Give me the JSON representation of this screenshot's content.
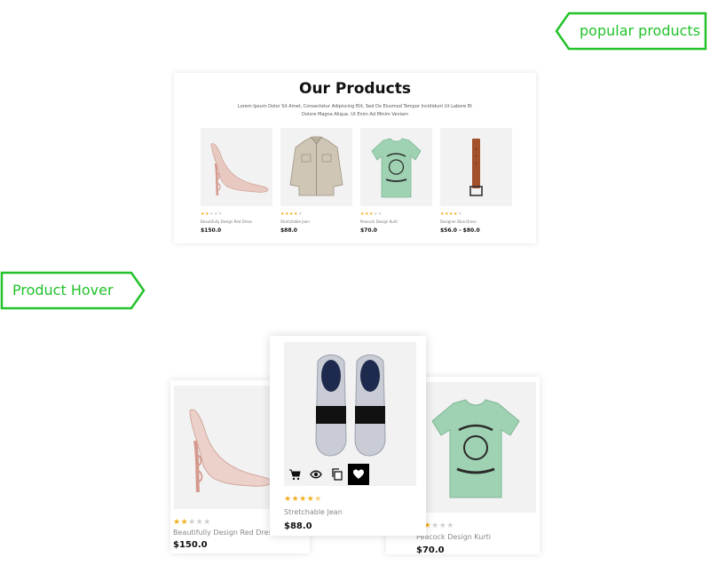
{
  "callouts": {
    "popular": "popular products",
    "hover": "Product Hover"
  },
  "colors": {
    "accent_green": "#22c22b",
    "star": "#f2b01e",
    "image_bg": "#f2f2f2"
  },
  "panel": {
    "title": "Our Products",
    "description": "Lorem Ipsum Dolor Sit Amet, Consectetur Adipiscing Elit, Sed Do Eiusmod Tempor Incididunt Ut Labore Et Dolore Magna Aliqua. Ut Enim Ad Minim Veniam",
    "products": [
      {
        "name": "Beautifully Design Red Dress",
        "price": "$150.0",
        "rating": 2,
        "icon": "high-heel-shoe"
      },
      {
        "name": "Stretchable Jean",
        "price": "$88.0",
        "rating": 4,
        "icon": "jacket"
      },
      {
        "name": "Peacock Design Kurti",
        "price": "$70.0",
        "rating": 3,
        "icon": "tshirt"
      },
      {
        "name": "Designer Blue Dress",
        "price": "$56.0 - $80.0",
        "rating": 4,
        "icon": "belt"
      }
    ]
  },
  "hover_section": {
    "cards": [
      {
        "name": "Beautifully Design Red Dress",
        "price": "$150.0",
        "rating": 2,
        "icon": "high-heel-shoe"
      },
      {
        "name": "Stretchable Jean",
        "price": "$88.0",
        "rating": 4.5,
        "icon": "sneakers"
      },
      {
        "name": "Peacock Design Kurti",
        "price": "$70.0",
        "rating": 2,
        "icon": "tshirt"
      }
    ],
    "actions": [
      "cart-icon",
      "eye-icon",
      "copy-icon",
      "heart-icon"
    ],
    "active_action": "heart-icon"
  }
}
